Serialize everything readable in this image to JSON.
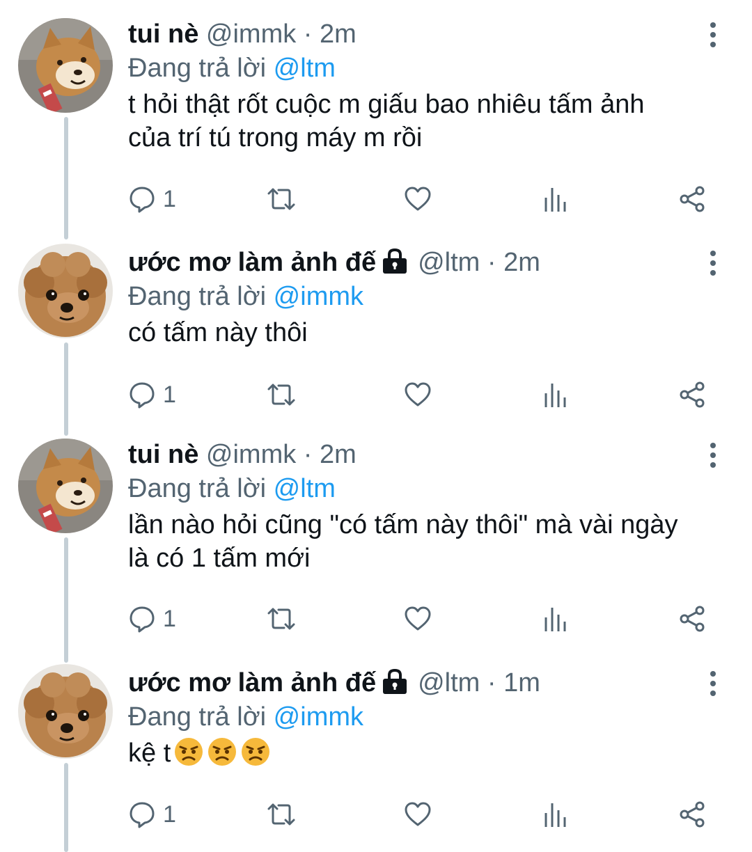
{
  "tweets": [
    {
      "name": "tui nè",
      "handle": "@immk",
      "separator": "·",
      "time": "2m",
      "locked": false,
      "avatar": "shiba-dog",
      "reply_prefix": "Đang trả lời",
      "reply_to": "@ltm",
      "text": "t hỏi thật rốt cuộc m giấu bao nhiêu tấm ảnh\ncủa trí tú trong máy m rồi",
      "emojis": [],
      "reply_count": "1"
    },
    {
      "name": "ước mơ làm ảnh đế",
      "handle": "@ltm",
      "separator": "·",
      "time": "2m",
      "locked": true,
      "avatar": "poodle-dog",
      "reply_prefix": "Đang trả lời",
      "reply_to": "@immk",
      "text": "có tấm này thôi",
      "emojis": [],
      "reply_count": "1"
    },
    {
      "name": "tui nè",
      "handle": "@immk",
      "separator": "·",
      "time": "2m",
      "locked": false,
      "avatar": "shiba-dog",
      "reply_prefix": "Đang trả lời",
      "reply_to": "@ltm",
      "text": "lần nào hỏi cũng \"có tấm này thôi\" mà vài ngày\nlà có 1 tấm mới",
      "emojis": [],
      "reply_count": "1"
    },
    {
      "name": "ước mơ làm ảnh đế",
      "handle": "@ltm",
      "separator": "·",
      "time": "1m",
      "locked": true,
      "avatar": "poodle-dog",
      "reply_prefix": "Đang trả lời",
      "reply_to": "@immk",
      "text": "kệ t",
      "emojis": [
        "angry-face",
        "angry-face",
        "angry-face"
      ],
      "reply_count": "1"
    }
  ],
  "icons": {
    "reply": "comment-icon",
    "retweet": "retweet-icon",
    "like": "heart-icon",
    "analytics": "analytics-icon",
    "share": "share-icon",
    "more": "more-vertical-icon",
    "lock": "lock-icon"
  },
  "colors": {
    "mention": "#1d9bf0",
    "secondary_text": "#536471",
    "thread_line": "#c4cfd6",
    "primary_text": "#0f1419"
  }
}
